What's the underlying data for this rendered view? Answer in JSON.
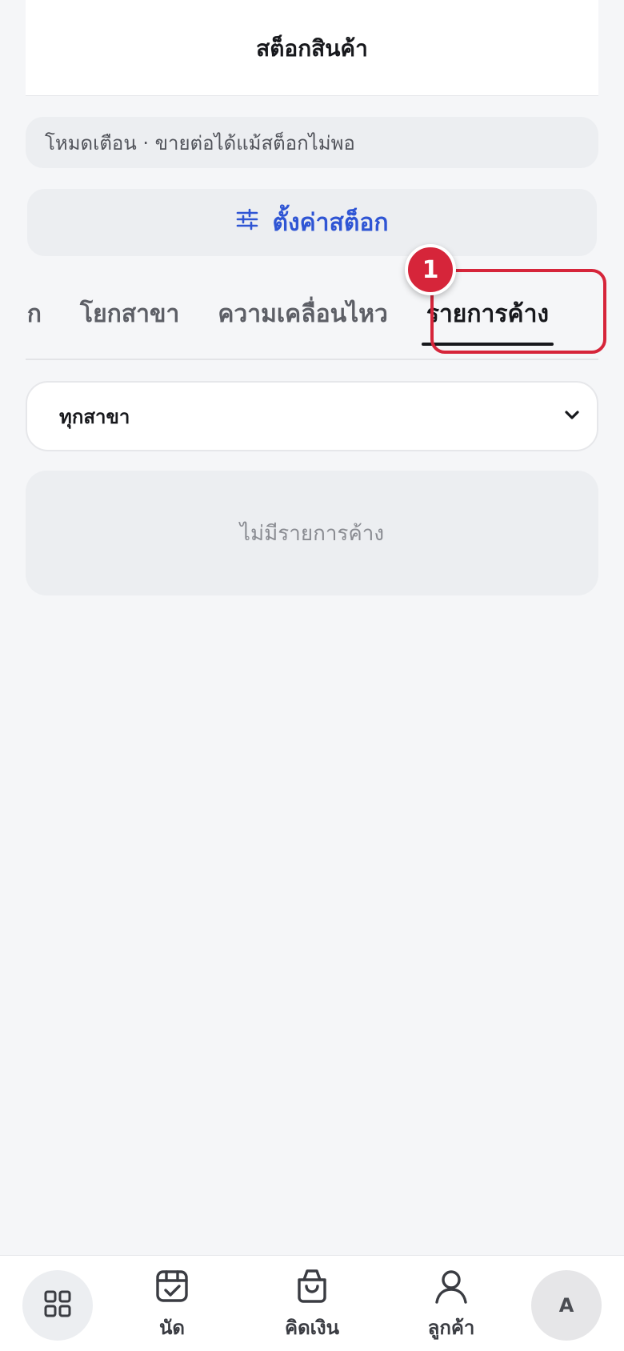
{
  "header": {
    "title": "สต็อกสินค้า"
  },
  "notice": {
    "text": "โหมดเตือน · ขายต่อได้แม้สต็อกไม่พอ"
  },
  "settings": {
    "label": "ตั้งค่าสต็อก",
    "icon": "sliders-icon",
    "color": "#2f55d4"
  },
  "tabs": [
    {
      "label": "สต็อก",
      "active": false
    },
    {
      "label": "โยกสาขา",
      "active": false
    },
    {
      "label": "ความเคลื่อนไหว",
      "active": false
    },
    {
      "label": "รายการค้าง",
      "active": true
    }
  ],
  "highlight": {
    "badge": "1",
    "color": "#d6253a"
  },
  "branch_select": {
    "value": "ทุกสาขา"
  },
  "empty_state": {
    "text": "ไม่มีรายการค้าง"
  },
  "bottom_nav": {
    "items": [
      {
        "label": "",
        "icon": "grid-icon"
      },
      {
        "label": "นัด",
        "icon": "calendar-check-icon"
      },
      {
        "label": "คิดเงิน",
        "icon": "shopping-bag-icon"
      },
      {
        "label": "ลูกค้า",
        "icon": "user-icon"
      }
    ],
    "avatar": "A"
  }
}
